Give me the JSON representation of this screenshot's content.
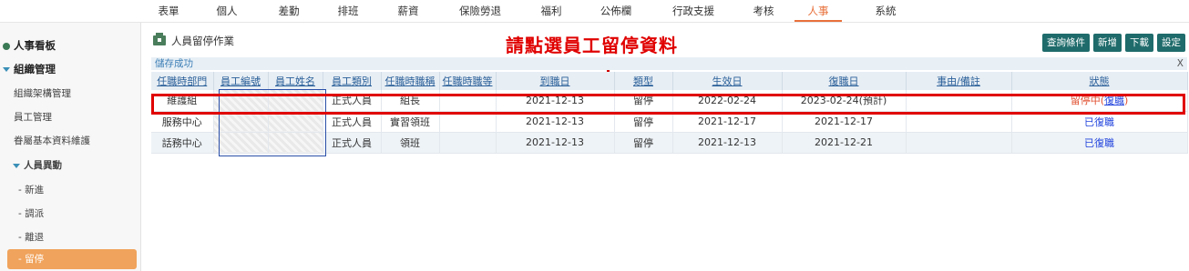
{
  "topnav": {
    "items": [
      "表單",
      "個人",
      "差勤",
      "排班",
      "薪資",
      "保險勞退",
      "福利",
      "公佈欄",
      "行政支援",
      "考核",
      "人事",
      "系統"
    ],
    "active": "人事"
  },
  "sidebar": {
    "hr_dashboard": "人事看板",
    "org_management": "組織管理",
    "org_structure": "組織架構管理",
    "employee_management": "員工管理",
    "family_basic": "眷屬基本資料維護",
    "personnel_changes": "人員異動",
    "new_hire": "- 新進",
    "transfer": "- 調派",
    "resign": "- 離退",
    "suspend": "- 留停"
  },
  "page": {
    "title": "人員留停作業",
    "annotation": "請點選員工留停資料",
    "status": "儲存成功",
    "close": "X",
    "buttons": {
      "query": "查詢條件",
      "add": "新增",
      "download": "下載",
      "settings": "設定"
    }
  },
  "table": {
    "headers": [
      "任職時部門",
      "員工編號",
      "員工姓名",
      "員工類別",
      "任職時職稱",
      "任職時職等",
      "到職日",
      "類型",
      "生效日",
      "復職日",
      "事由/備註",
      "狀態"
    ],
    "rows": [
      {
        "dept": "維護組",
        "emp_type": "正式人員",
        "title": "組長",
        "hire_date": "2021-12-13",
        "type": "留停",
        "effective": "2022-02-24",
        "return": "2023-02-24(預計)",
        "note": "",
        "status_main": "留停中(",
        "status_link": "復職",
        "status_end": ")"
      },
      {
        "dept": "服務中心",
        "emp_type": "正式人員",
        "title": "實習領班",
        "hire_date": "2021-12-13",
        "type": "留停",
        "effective": "2021-12-17",
        "return": "2021-12-17",
        "note": "",
        "status": "已復職"
      },
      {
        "dept": "話務中心",
        "emp_type": "正式人員",
        "title": "領班",
        "hire_date": "2021-12-13",
        "type": "留停",
        "effective": "2021-12-13",
        "return": "2021-12-21",
        "note": "",
        "status": "已復職"
      }
    ]
  },
  "colors": {
    "accent": "#e8703a",
    "button": "#1f6b6b",
    "annotation": "#e00000",
    "link": "#2244dd"
  }
}
